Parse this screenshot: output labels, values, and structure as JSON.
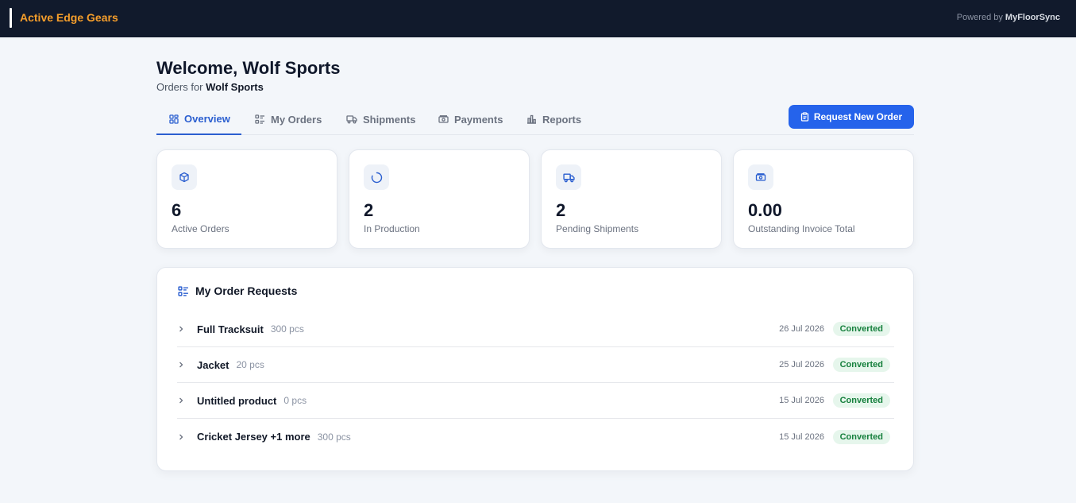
{
  "app": {
    "brand": "Active Edge Gears",
    "powered_prefix": "Powered by",
    "powered_name": "MyFloorSync"
  },
  "header": {
    "welcome": "Welcome, Wolf Sports",
    "subtitle_prefix": "Orders for",
    "subtitle_customer": "Wolf Sports"
  },
  "tabs": [
    {
      "label": "Overview",
      "icon": "grid-icon",
      "active": true
    },
    {
      "label": "My Orders",
      "icon": "list-icon",
      "active": false
    },
    {
      "label": "Shipments",
      "icon": "truck-icon",
      "active": false
    },
    {
      "label": "Payments",
      "icon": "banknote-icon",
      "active": false
    },
    {
      "label": "Reports",
      "icon": "bar-chart-icon",
      "active": false
    }
  ],
  "actions": {
    "request_new_order": "Request New Order"
  },
  "stats": [
    {
      "value": "6",
      "label": "Active Orders",
      "icon": "box-icon"
    },
    {
      "value": "2",
      "label": "In Production",
      "icon": "spinner-icon"
    },
    {
      "value": "2",
      "label": "Pending Shipments",
      "icon": "truck-icon"
    },
    {
      "value": "0.00",
      "label": "Outstanding Invoice Total",
      "icon": "banknote-icon"
    }
  ],
  "order_requests": {
    "title": "My Order Requests",
    "items": [
      {
        "name": "Full Tracksuit",
        "qty": "300 pcs",
        "date": "26 Jul 2026",
        "status": "Converted"
      },
      {
        "name": "Jacket",
        "qty": "20 pcs",
        "date": "25 Jul 2026",
        "status": "Converted"
      },
      {
        "name": "Untitled product",
        "qty": "0 pcs",
        "date": "15 Jul 2026",
        "status": "Converted"
      },
      {
        "name": "Cricket Jersey +1 more",
        "qty": "300 pcs",
        "date": "15 Jul 2026",
        "status": "Converted"
      }
    ]
  },
  "colors": {
    "topbar": "#111a2c",
    "brand": "#f59e2b",
    "accent": "#2563eb",
    "badge_bg": "#e6f6ec",
    "badge_text": "#16803d"
  }
}
